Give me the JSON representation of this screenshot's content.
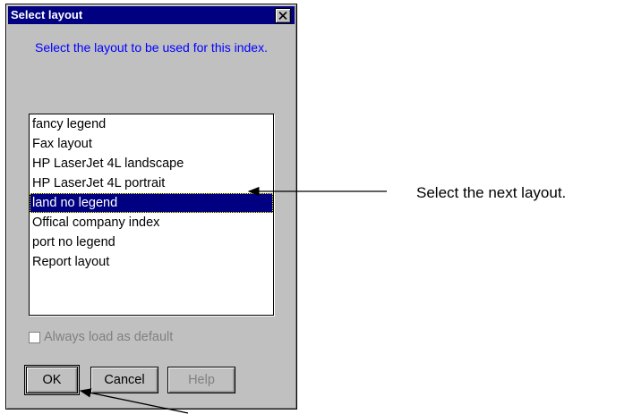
{
  "dialog": {
    "title": "Select layout",
    "instruction": "Select the layout to be used for this index.",
    "layouts": [
      "fancy legend",
      "Fax layout",
      "HP LaserJet 4L landscape",
      "HP LaserJet 4L portrait",
      "land no legend",
      "Offical company index",
      "port no legend",
      "Report layout"
    ],
    "selected_layout": "land no legend",
    "checkbox_label": "Always load as default",
    "buttons": {
      "ok": "OK",
      "cancel": "Cancel",
      "help": "Help"
    }
  },
  "annotation": {
    "callout_text": "Select the next layout."
  }
}
